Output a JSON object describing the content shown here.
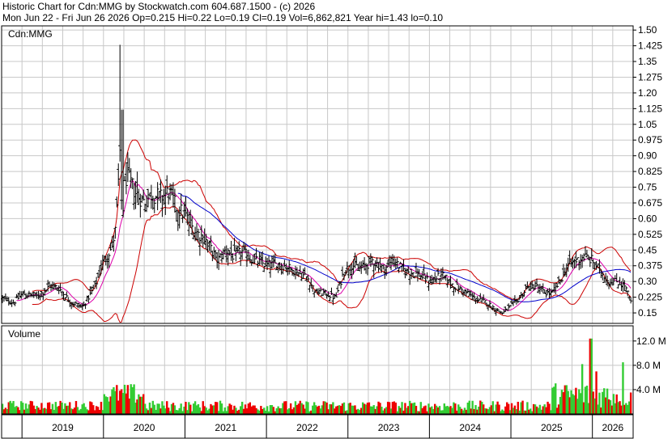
{
  "header": {
    "line1": "Historic Chart for Cdn:MMG by Stockwatch.com 604.687.1500 - (c) 2026",
    "line2": "Mon Jun 22 - Fri Jun 26 2026   Op=0.215   Hi=0.22   Lo=0.19   Cl=0.19   Vol=6,862,821   Year hi=1.43   lo=0.10"
  },
  "chart_data": [
    {
      "type": "ohlc",
      "symbol_label": "Cdn:MMG",
      "overlays": [
        "bollinger-bands",
        "moving-average-short",
        "moving-average-long"
      ],
      "colors": {
        "price": "#000000",
        "bollinger": "#cc0000",
        "ma_short": "#dd00aa",
        "ma_long": "#0000cc",
        "grid": "#c8c8c8"
      },
      "y_ticks": [
        "1.50",
        "1.425",
        "1.35",
        "1.275",
        "1.20",
        "1.125",
        "1.05",
        "0.975",
        "0.90",
        "0.825",
        "0.75",
        "0.675",
        "0.60",
        "0.525",
        "0.45",
        "0.375",
        "0.30",
        "0.225",
        "0.15"
      ],
      "ylim": [
        0.1,
        1.52
      ],
      "x_range": [
        2018.75,
        2026.5
      ],
      "x_ticks": [
        "2019",
        "2020",
        "2021",
        "2022",
        "2023",
        "2024",
        "2025",
        "2026"
      ],
      "anchors": {
        "x": [
          2018.75,
          2018.9,
          2019.0,
          2019.2,
          2019.35,
          2019.45,
          2019.6,
          2019.75,
          2019.9,
          2020.0,
          2020.1,
          2020.15,
          2020.18,
          2020.2,
          2020.23,
          2020.27,
          2020.32,
          2020.4,
          2020.5,
          2020.6,
          2020.7,
          2020.8,
          2020.9,
          2021.0,
          2021.1,
          2021.25,
          2021.4,
          2021.5,
          2021.6,
          2021.7,
          2021.85,
          2022.0,
          2022.2,
          2022.35,
          2022.5,
          2022.6,
          2022.75,
          2022.85,
          2022.95,
          2023.05,
          2023.15,
          2023.3,
          2023.45,
          2023.55,
          2023.7,
          2023.85,
          2024.0,
          2024.15,
          2024.3,
          2024.45,
          2024.55,
          2024.7,
          2024.8,
          2024.9,
          2025.0,
          2025.1,
          2025.2,
          2025.3,
          2025.4,
          2025.5,
          2025.6,
          2025.7,
          2025.8,
          2025.9,
          2026.0,
          2026.1,
          2026.2,
          2026.3,
          2026.4,
          2026.48
        ],
        "close": [
          0.22,
          0.2,
          0.24,
          0.23,
          0.28,
          0.27,
          0.2,
          0.18,
          0.28,
          0.4,
          0.46,
          0.55,
          0.75,
          0.9,
          0.6,
          0.8,
          0.78,
          0.72,
          0.68,
          0.72,
          0.7,
          0.73,
          0.65,
          0.62,
          0.55,
          0.5,
          0.4,
          0.45,
          0.42,
          0.44,
          0.4,
          0.38,
          0.38,
          0.35,
          0.32,
          0.25,
          0.24,
          0.22,
          0.35,
          0.38,
          0.36,
          0.4,
          0.36,
          0.4,
          0.35,
          0.34,
          0.3,
          0.33,
          0.28,
          0.25,
          0.22,
          0.2,
          0.17,
          0.15,
          0.18,
          0.22,
          0.27,
          0.28,
          0.25,
          0.24,
          0.3,
          0.38,
          0.4,
          0.42,
          0.4,
          0.35,
          0.3,
          0.3,
          0.28,
          0.19
        ]
      },
      "volume": {
        "label": "Volume",
        "unit": "M",
        "y_ticks": [
          "12.0 M",
          "8.0 M",
          "4.0 M"
        ],
        "ylim": [
          0,
          14.5
        ],
        "up_color": "#33cc33",
        "down_color": "#ee0000",
        "spikes": [
          [
            2025.98,
            12.4
          ],
          [
            2026.37,
            8.5
          ],
          [
            2025.88,
            8.2
          ],
          [
            2026.05,
            7.0
          ]
        ]
      }
    }
  ]
}
